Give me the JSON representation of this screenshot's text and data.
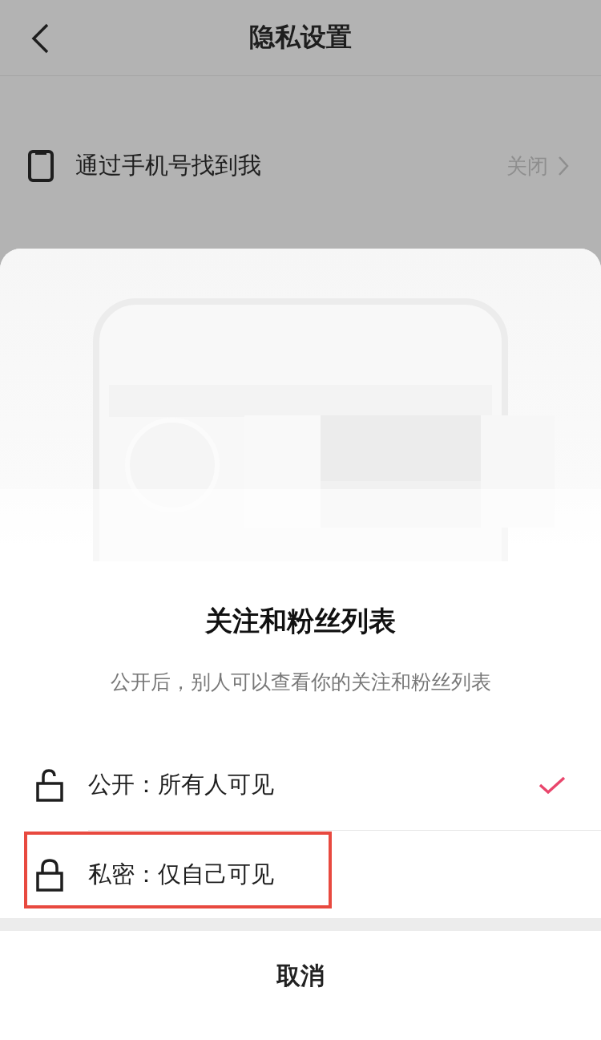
{
  "header": {
    "title": "隐私设置"
  },
  "settings": [
    {
      "kind": "phone",
      "label": "通过手机号找到我",
      "value": "关闭"
    }
  ],
  "sheet": {
    "title": "关注和粉丝列表",
    "description": "公开后，别人可以查看你的关注和粉丝列表",
    "options": [
      {
        "kind": "unlocked",
        "label": "公开：所有人可见",
        "selected": true,
        "highlighted": false
      },
      {
        "kind": "locked",
        "label": "私密：仅自己可见",
        "selected": false,
        "highlighted": true
      }
    ],
    "cancel": "取消"
  }
}
